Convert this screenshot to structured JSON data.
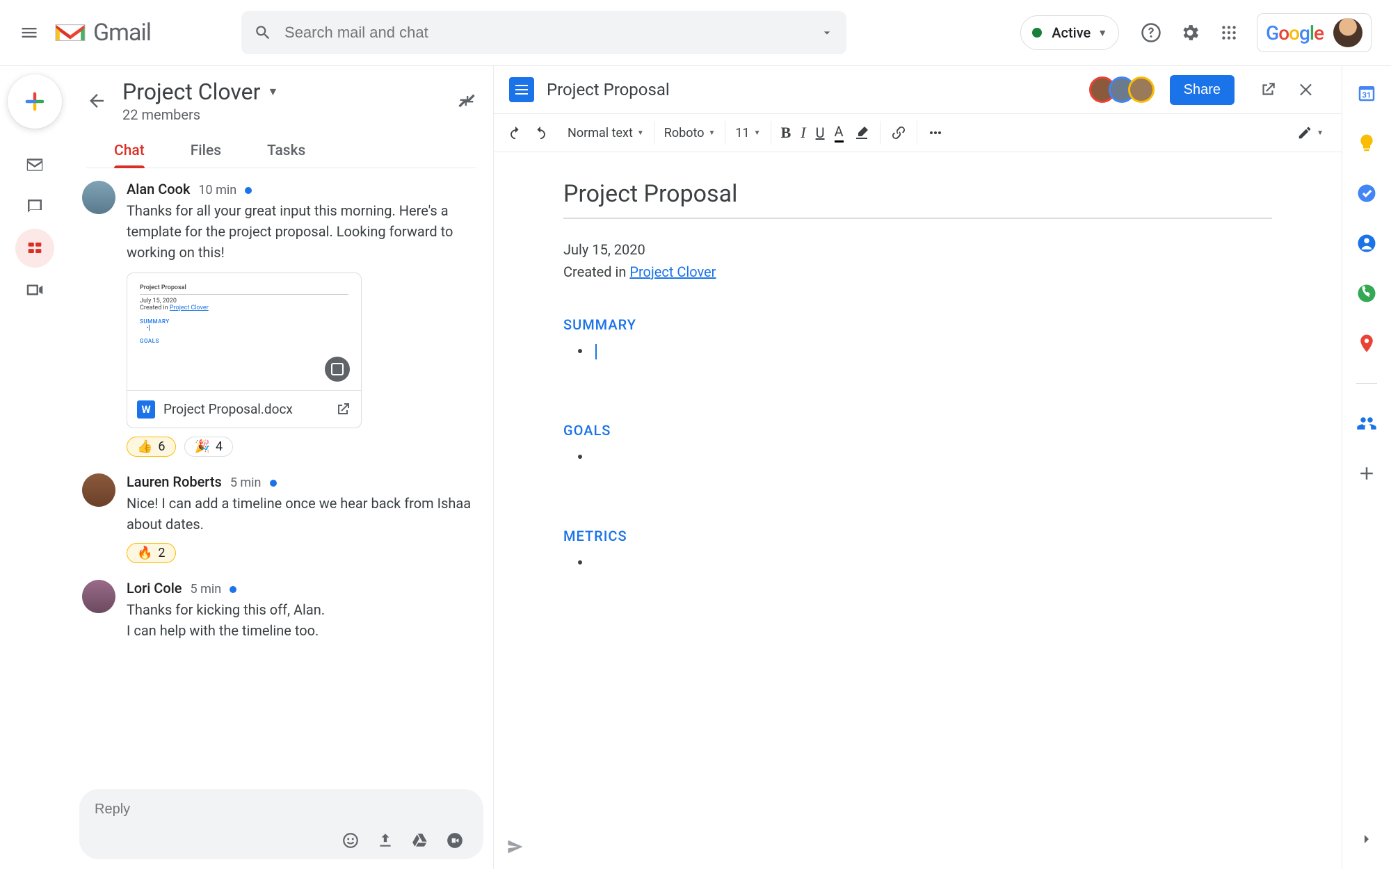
{
  "app": {
    "name": "Gmail"
  },
  "search": {
    "placeholder": "Search mail and chat"
  },
  "status": {
    "label": "Active"
  },
  "google": {
    "label": "Google"
  },
  "room": {
    "title": "Project Clover",
    "members": "22 members",
    "tabs": [
      "Chat",
      "Files",
      "Tasks"
    ]
  },
  "messages": [
    {
      "author": "Alan Cook",
      "time": "10 min",
      "unread": true,
      "text": "Thanks for all your great input this morning. Here's a template for the project proposal. Looking forward to working on this!",
      "attachment": {
        "filename": "Project Proposal.docx",
        "preview": {
          "title": "Project Proposal",
          "date": "July 15, 2020",
          "created_prefix": "Created in ",
          "created_link": "Project Clover",
          "sections": [
            "SUMMARY",
            "GOALS"
          ]
        }
      },
      "reactions": [
        {
          "emoji": "👍",
          "count": "6",
          "selected": true
        },
        {
          "emoji": "🎉",
          "count": "4",
          "selected": false
        }
      ]
    },
    {
      "author": "Lauren Roberts",
      "time": "5 min",
      "unread": true,
      "text": "Nice! I can add a timeline once we hear back from Ishaa about dates.",
      "reactions": [
        {
          "emoji": "🔥",
          "count": "2",
          "selected": true
        }
      ]
    },
    {
      "author": "Lori Cole",
      "time": "5 min",
      "unread": true,
      "text": "Thanks for kicking this off, Alan.\nI can help with the timeline too."
    }
  ],
  "reply": {
    "placeholder": "Reply"
  },
  "doc": {
    "title": "Project Proposal",
    "share": "Share",
    "toolbar": {
      "style": "Normal text",
      "font": "Roboto",
      "size": "11"
    },
    "body": {
      "heading": "Project Proposal",
      "date": "July 15, 2020",
      "created_prefix": "Created in ",
      "created_link": "Project Clover",
      "sections": [
        "SUMMARY",
        "GOALS",
        "METRICS"
      ]
    }
  }
}
